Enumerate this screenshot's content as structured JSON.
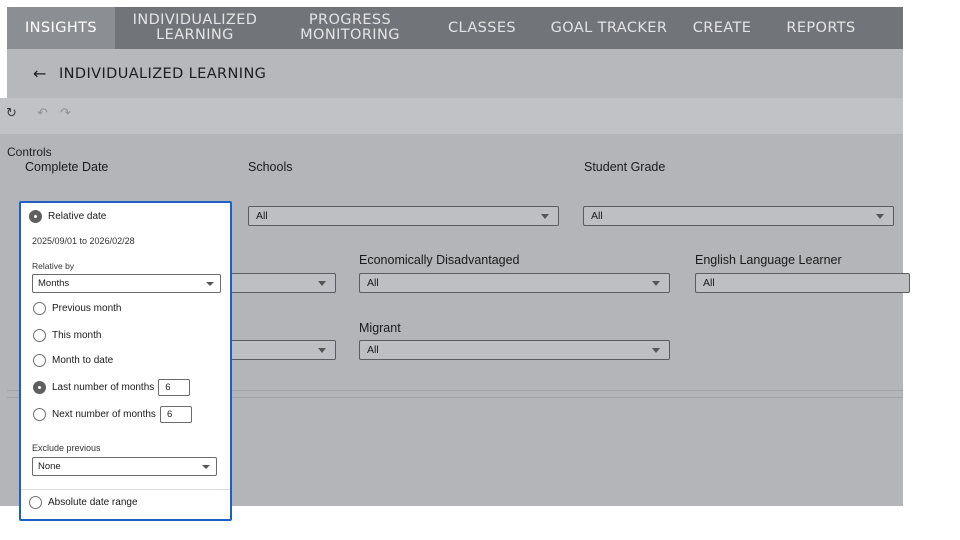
{
  "nav": {
    "insights": "INSIGHTS",
    "individualized": "INDIVIDUALIZED\nLEARNING",
    "progress": "PROGRESS\nMONITORING",
    "classes": "CLASSES",
    "goal_tracker": "GOAL TRACKER",
    "create": "CREATE",
    "reports": "REPORTS"
  },
  "header": {
    "back_icon": "←",
    "title": "INDIVIDUALIZED LEARNING"
  },
  "toolbar": {
    "reset_icon": "↻",
    "undo_icon": "↶",
    "redo_icon": "↷"
  },
  "controls": {
    "title": "Controls",
    "complete_date_label": "Complete Date",
    "schools": {
      "label": "Schools",
      "value": "All"
    },
    "student_grade": {
      "label": "Student Grade",
      "value": "All"
    },
    "row2_left": {
      "value": ""
    },
    "economically_disadvantaged": {
      "label": "Economically Disadvantaged",
      "value": "All"
    },
    "english_language_learner": {
      "label": "English Language Learner",
      "value": "All"
    },
    "row3_left": {
      "value": ""
    },
    "migrant": {
      "label": "Migrant",
      "value": "All"
    }
  },
  "date_popup": {
    "relative_date": "Relative date",
    "range_text": "2025/09/01 to 2026/02/28",
    "relative_by_label": "Relative by",
    "relative_by_value": "Months",
    "previous_month": "Previous month",
    "this_month": "This month",
    "month_to_date": "Month to date",
    "last_number_of_months": "Last number of months",
    "last_number_value": "6",
    "next_number_of_months": "Next number of months",
    "next_number_value": "6",
    "exclude_previous_label": "Exclude previous",
    "exclude_previous_value": "None",
    "absolute_date_range": "Absolute date range",
    "selected_option": "last_number_of_months"
  },
  "colors": {
    "nav_bg": "#717478",
    "nav_active_bg": "#8b8e92",
    "header_bg": "#b6b8bc",
    "panel_bg": "#b3b5b9",
    "popup_border": "#1f5fc4"
  }
}
